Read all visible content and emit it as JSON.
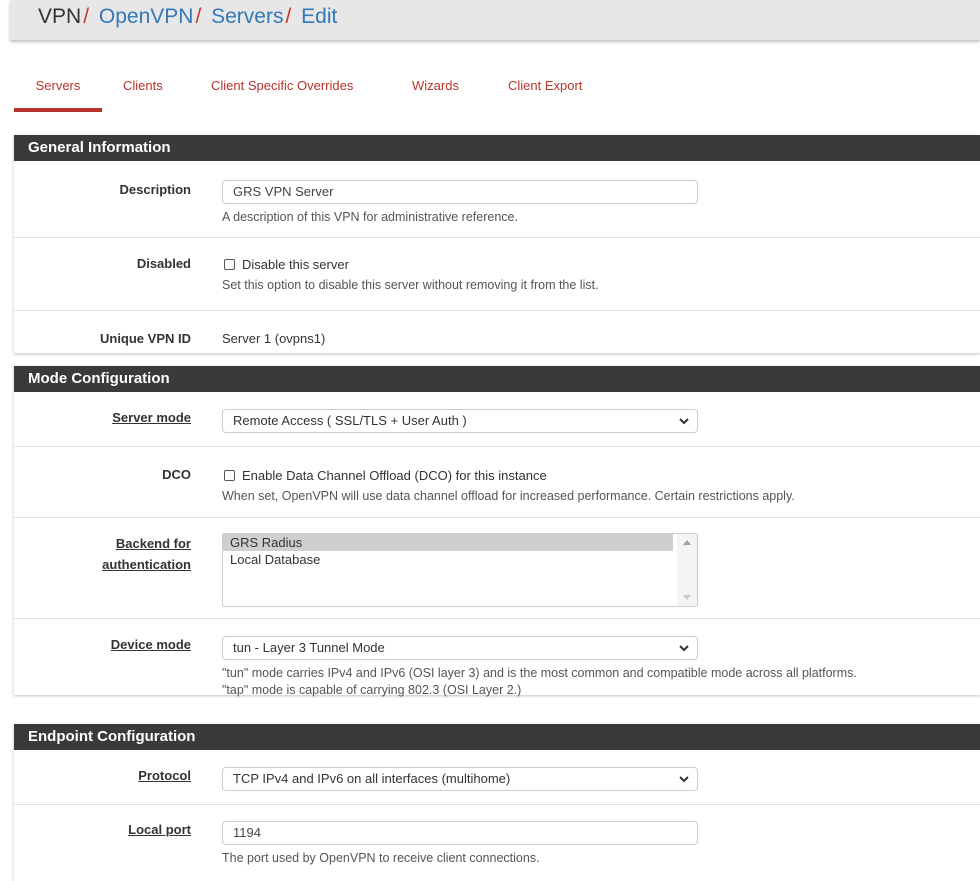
{
  "breadcrumb": {
    "root": "VPN",
    "sep": "/",
    "items": [
      "OpenVPN",
      "Servers",
      "Edit"
    ]
  },
  "tabs": [
    {
      "label": "Servers",
      "active": true
    },
    {
      "label": "Clients",
      "active": false
    },
    {
      "label": "Client Specific Overrides",
      "active": false
    },
    {
      "label": "Wizards",
      "active": false
    },
    {
      "label": "Client Export",
      "active": false
    }
  ],
  "general": {
    "heading": "General Information",
    "description": {
      "label": "Description",
      "value": "GRS VPN Server",
      "help": "A description of this VPN for administrative reference."
    },
    "disabled": {
      "label": "Disabled",
      "checkbox_label": "Disable this server",
      "checked": false,
      "help": "Set this option to disable this server without removing it from the list."
    },
    "unique_id": {
      "label": "Unique VPN ID",
      "value": "Server 1 (ovpns1)"
    }
  },
  "mode": {
    "heading": "Mode Configuration",
    "server_mode": {
      "label": "Server mode",
      "value": "Remote Access ( SSL/TLS + User Auth )"
    },
    "dco": {
      "label": "DCO",
      "checkbox_label": "Enable Data Channel Offload (DCO) for this instance",
      "checked": false,
      "help": "When set, OpenVPN will use data channel offload for increased performance. Certain restrictions apply."
    },
    "backend": {
      "label_line1": "Backend for",
      "label_line2": "authentication",
      "options": [
        "GRS Radius",
        "Local Database"
      ],
      "selected": "GRS Radius"
    },
    "device_mode": {
      "label": "Device mode",
      "value": "tun - Layer 3 Tunnel Mode",
      "help_line1": "\"tun\" mode carries IPv4 and IPv6 (OSI layer 3) and is the most common and compatible mode across all platforms.",
      "help_line2": "\"tap\" mode is capable of carrying 802.3 (OSI Layer 2.)"
    }
  },
  "endpoint": {
    "heading": "Endpoint Configuration",
    "protocol": {
      "label": "Protocol",
      "value": "TCP IPv4 and IPv6 on all interfaces (multihome)"
    },
    "local_port": {
      "label": "Local port",
      "value": "1194",
      "help": "The port used by OpenVPN to receive client connections."
    }
  },
  "colors": {
    "accent": "#b7332b",
    "link": "#3478b7",
    "panel_heading_bg": "#3a3a3a"
  }
}
